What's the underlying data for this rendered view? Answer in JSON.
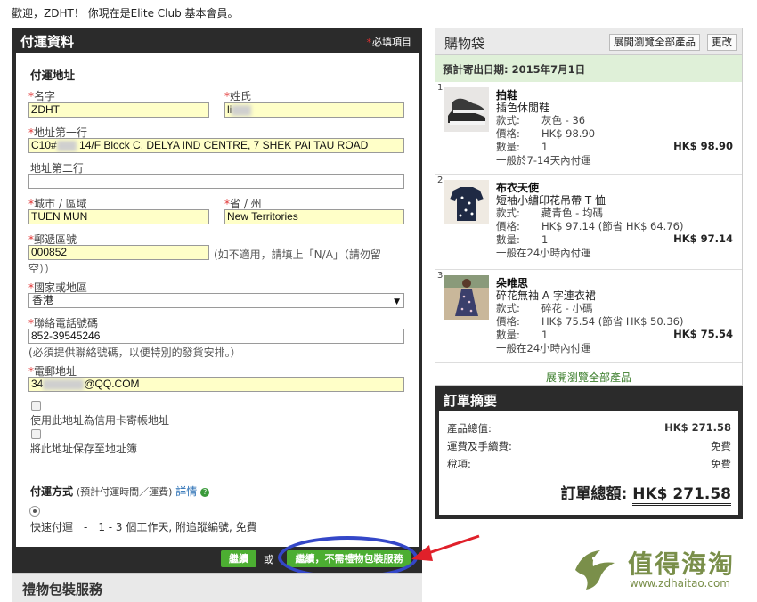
{
  "welcome": "歡迎，ZDHT！ 你現在是Elite Club 基本會員。",
  "shipping": {
    "title": "付運資料",
    "required_note": "必填項目",
    "address_section": "付運地址",
    "first_name_label": "名字",
    "first_name_value": "ZDHT",
    "last_name_label": "姓氏",
    "last_name_value": "li",
    "addr1_label": "地址第一行",
    "addr1_prefix": "C10#",
    "addr1_rest": " 14/F Block C, DELYA IND CENTRE, 7 SHEK PAI TAU ROAD",
    "addr2_label": "地址第二行",
    "addr2_value": "",
    "city_label": "城市 / 區域",
    "city_value": "TUEN MUN",
    "province_label": "省 / 州",
    "province_value": "New Territories",
    "postal_label": "郵遞區號",
    "postal_value": "000852",
    "postal_note_1": "(如不適用，請填上「N/A」（請勿留",
    "postal_note_2": "空））",
    "country_label": "國家或地區",
    "country_value": "香港",
    "phone_label": "聯絡電話號碼",
    "phone_value": "852-39545246",
    "phone_note": "(必須提供聯絡號碼，以便特別的發貨安排。）",
    "email_label": "電郵地址",
    "email_prefix": "34",
    "email_suffix": "@QQ.COM",
    "billing_checkbox_label": "使用此地址為信用卡寄帳地址",
    "save_checkbox_label": "將此地址保存至地址簿",
    "method_title": "付運方式",
    "method_sub": "(預計付運時間／運費)",
    "method_details": "詳情",
    "method_option": "快速付運　-　1 - 3 個工作天, 附追蹤編號, 免費"
  },
  "buttons": {
    "continue": "繼續",
    "or": "或",
    "continue_no_gift": "繼續，不需禮物包裝服務"
  },
  "gift": {
    "title": "禮物包裝服務"
  },
  "cart": {
    "title": "購物袋",
    "expand_btn": "展開瀏覽全部產品",
    "edit_btn": "更改",
    "ship_date": "預計寄出日期: 2015年7月1日",
    "expand_link": "展開瀏覽全部產品",
    "items": [
      {
        "num": "1",
        "name": "拍鞋",
        "desc": "插色休閒鞋",
        "style_k": "款式:",
        "style_v": "灰色 - 36",
        "price_k": "價格:",
        "price_v": "HK$ 98.90",
        "qty_k": "數量:",
        "qty_v": "1",
        "total": "HK$ 98.90",
        "ship": "一般於7-14天內付運"
      },
      {
        "num": "2",
        "name": "布衣天使",
        "desc": "短袖小繡印花吊帶 T 恤",
        "style_k": "款式:",
        "style_v": "藏青色 - 均碼",
        "price_k": "價格:",
        "price_v": "HK$ 97.14 (節省 HK$ 64.76)",
        "qty_k": "數量:",
        "qty_v": "1",
        "total": "HK$ 97.14",
        "ship": "一般在24小時內付運"
      },
      {
        "num": "3",
        "name": "朵唯思",
        "desc": "碎花無袖 A 字連衣裙",
        "style_k": "款式:",
        "style_v": "碎花 - 小碼",
        "price_k": "價格:",
        "price_v": "HK$ 75.54 (節省 HK$ 50.36)",
        "qty_k": "數量:",
        "qty_v": "1",
        "total": "HK$ 75.54",
        "ship": "一般在24小時內付運"
      }
    ]
  },
  "summary": {
    "title": "訂單摘要",
    "subtotal_k": "產品總值:",
    "subtotal_v": "HK$ 271.58",
    "shipping_k": "運費及手續費:",
    "shipping_v": "免費",
    "tax_k": "稅項:",
    "tax_v": "免費",
    "total_k": "訂單總額:",
    "total_v": "HK$ 271.58"
  },
  "watermark": {
    "title": "值得海淘",
    "url": "www.zdhaitao.com"
  },
  "colors": {
    "panel_dark": "#2b2b2b",
    "field_yellow": "#ffffc8",
    "button_green": "#4cae32",
    "annotation_blue": "#3447c8",
    "annotation_red": "#e0202a"
  }
}
